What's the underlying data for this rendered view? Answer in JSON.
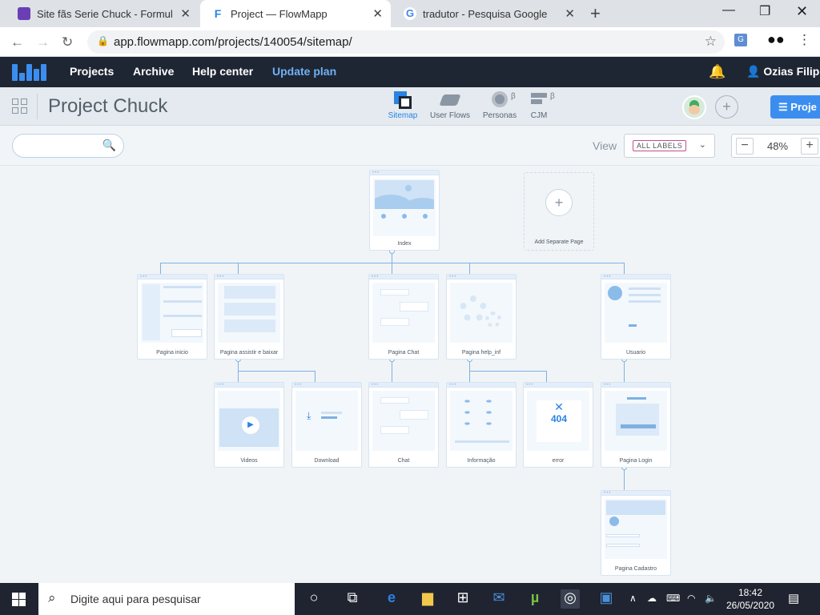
{
  "browser": {
    "tabs": [
      {
        "title": "Site fãs Serie Chuck - Formulário",
        "icon": "forms-icon",
        "color": "#6a3fb5"
      },
      {
        "title": "Project — FlowMapp",
        "icon": "flowmapp-icon",
        "color": "#2a83e6"
      },
      {
        "title": "tradutor - Pesquisa Google",
        "icon": "google-icon",
        "color": "#4285f4"
      }
    ],
    "url": "app.flowmapp.com/projects/140054/sitemap/"
  },
  "app": {
    "menu": [
      "Projects",
      "Archive",
      "Help center",
      "Update plan"
    ],
    "user": "Ozias Filipe",
    "accent": "#3b8ef0"
  },
  "project": {
    "title": "Project Chuck",
    "views": [
      {
        "label": "Sitemap",
        "icon": "sitemap-icon",
        "active": true
      },
      {
        "label": "User Flows",
        "icon": "user-flows-icon",
        "beta": false
      },
      {
        "label": "Personas",
        "icon": "personas-icon",
        "beta": true
      },
      {
        "label": "CJM",
        "icon": "cjm-icon",
        "beta": true
      }
    ],
    "beta_mark": "β",
    "button": "Proje"
  },
  "toolbar": {
    "view_label": "View",
    "labels_filter": "ALL LABELS",
    "zoom": "48%"
  },
  "sitemap": {
    "pages": {
      "index": "Index",
      "inicio": "Pagina inicio",
      "assistir": "Pagina assistir e baixar",
      "chat_page": "Pagina Chat",
      "help": "Pagina help_inf",
      "usuario": "Usuario",
      "videos": "Videos",
      "download": "Download",
      "chat": "Chat",
      "informacao": "Informação",
      "error": "error",
      "login": "Pagina Login",
      "cadastro": "Pagina Cadastro"
    },
    "error_code": "404",
    "add_page": "Add Separate Page"
  },
  "taskbar": {
    "search_placeholder": "Digite aqui para pesquisar",
    "time": "18:42",
    "date": "26/05/2020"
  }
}
